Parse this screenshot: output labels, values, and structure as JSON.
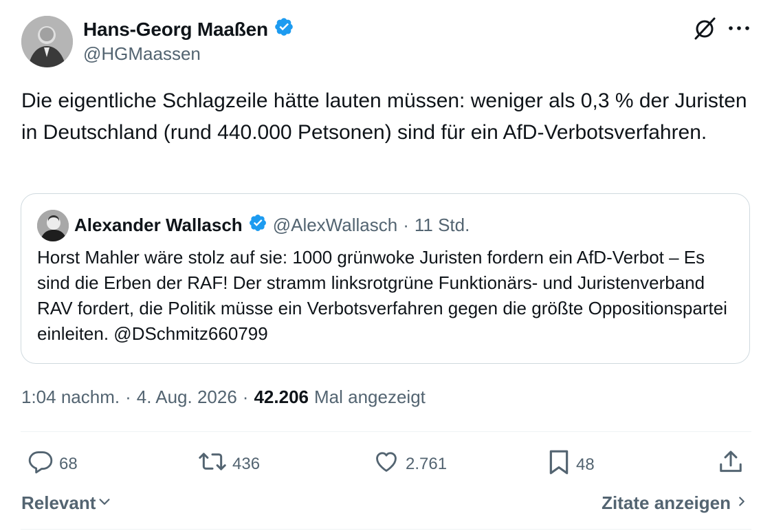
{
  "author": {
    "name": "Hans-Georg Maaßen",
    "handle": "@HGMaassen",
    "verified": true,
    "avatar_icon": "profile-photo"
  },
  "tweet": {
    "text": "Die eigentliche Schlagzeile hätte lauten müssen: weniger als 0,3 % der Juristen in Deutschland (rund 440.000 Petsonen) sind für ein AfD-Verbotsverfahren."
  },
  "quoted_tweet": {
    "name": "Alexander Wallasch",
    "handle": "@AlexWallasch",
    "separator": "·",
    "time": "11 Std.",
    "verified": true,
    "text": "Horst Mahler wäre stolz auf sie: 1000 grünwoke Juristen fordern ein AfD-Verbot – Es sind die Erben der RAF! Der stramm linksrotgrüne Funktionärs- und Juristenverband RAV fordert, die Politik müsse ein Verbotsverfahren gegen die größte Oppositionspartei einleiten. @DSchmitz660799"
  },
  "meta": {
    "time": "1:04 nachm.",
    "sep1": "·",
    "date": "4. Aug. 2026",
    "sep2": "·",
    "views_count": "42.206",
    "views_label": "Mal angezeigt"
  },
  "actions": {
    "replies": "68",
    "reposts": "436",
    "likes": "2.761",
    "bookmarks": "48"
  },
  "footer": {
    "sort_label": "Relevant",
    "quotes_label": "Zitate anzeigen"
  },
  "colors": {
    "text": "#0f1419",
    "secondary": "#536471",
    "verified": "#1d9bf0",
    "border": "#cfd9de",
    "divider": "#eff3f4"
  },
  "icons": [
    "grok-icon",
    "more-icon",
    "verified-badge-icon",
    "reply-icon",
    "repost-icon",
    "like-icon",
    "bookmark-icon",
    "share-icon",
    "chevron-down-icon",
    "chevron-right-icon"
  ]
}
